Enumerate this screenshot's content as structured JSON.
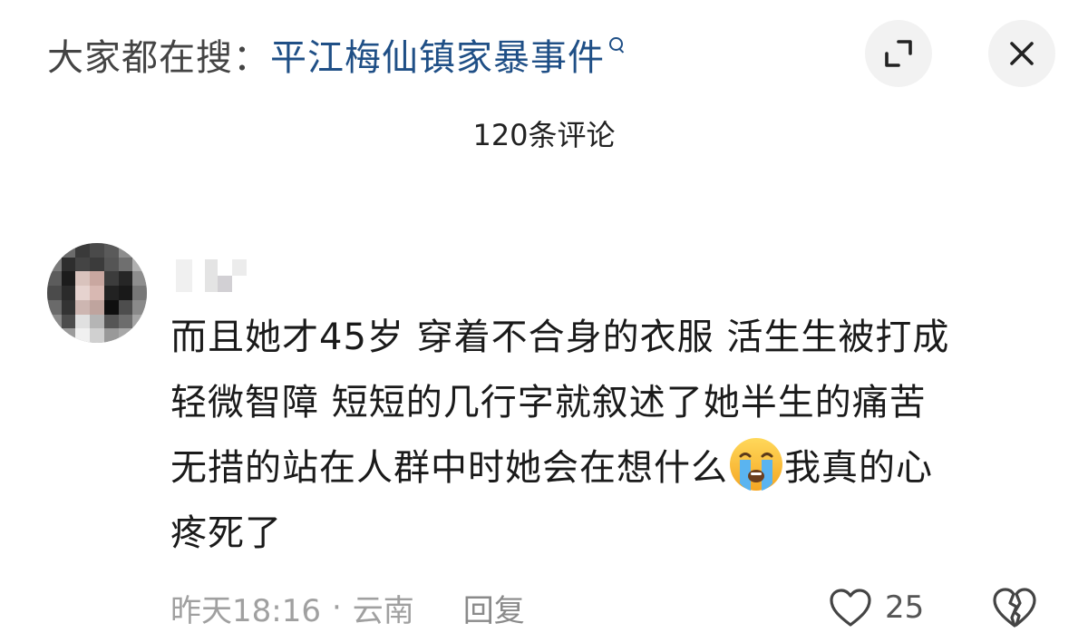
{
  "header": {
    "search_prefix": "大家都在搜：",
    "search_query": "平江梅仙镇家暴事件",
    "query_color": "#1f4f86",
    "buttons": [
      "collapse-icon",
      "close-icon"
    ]
  },
  "comments_header": {
    "count_label": "120条评论"
  },
  "comment": {
    "lines": [
      "而且她才45岁 穿着不合身的衣服 活生生被打成",
      "轻微智障 短短的几行字就叙述了她半生的痛苦",
      "无措的站在人群中时她会在想什么",
      "我真的心",
      "疼死了"
    ],
    "emoji": "loudly-crying-face",
    "time": "昨天18:16",
    "separator": "·",
    "location": "云南",
    "reply_label": "回复",
    "like_count": "25"
  }
}
